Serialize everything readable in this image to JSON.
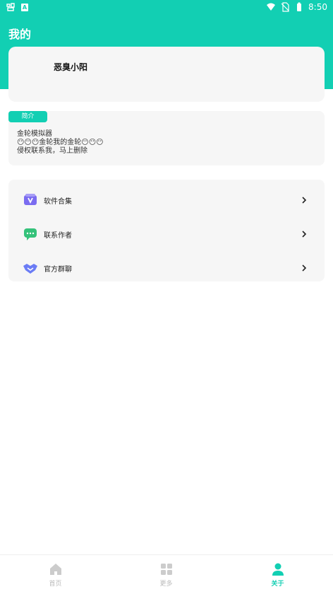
{
  "status_bar": {
    "time": "8:50",
    "left_icons": [
      "app-icon",
      "a-badge-icon"
    ],
    "right_icons": [
      "wifi-icon",
      "no-sim-icon",
      "battery-icon"
    ]
  },
  "header": {
    "title": "我的",
    "accent_color": "#12cfb3"
  },
  "profile": {
    "username": "恶臭小阳"
  },
  "intro": {
    "badge": "简介",
    "lines": [
      "金轮模拟器",
      "😶😶😶金轮我的金轮😶😶😶",
      "侵权联系我，马上删除"
    ]
  },
  "menu": {
    "items": [
      {
        "label": "软件合集",
        "icon": "software-collection-icon"
      },
      {
        "label": "联系作者",
        "icon": "chat-icon"
      },
      {
        "label": "官方群聊",
        "icon": "handshake-icon"
      }
    ]
  },
  "bottom_nav": {
    "items": [
      {
        "label": "首页",
        "icon": "home-icon",
        "active": false
      },
      {
        "label": "更多",
        "icon": "grid-icon",
        "active": false
      },
      {
        "label": "关于",
        "icon": "person-icon",
        "active": true
      }
    ]
  }
}
